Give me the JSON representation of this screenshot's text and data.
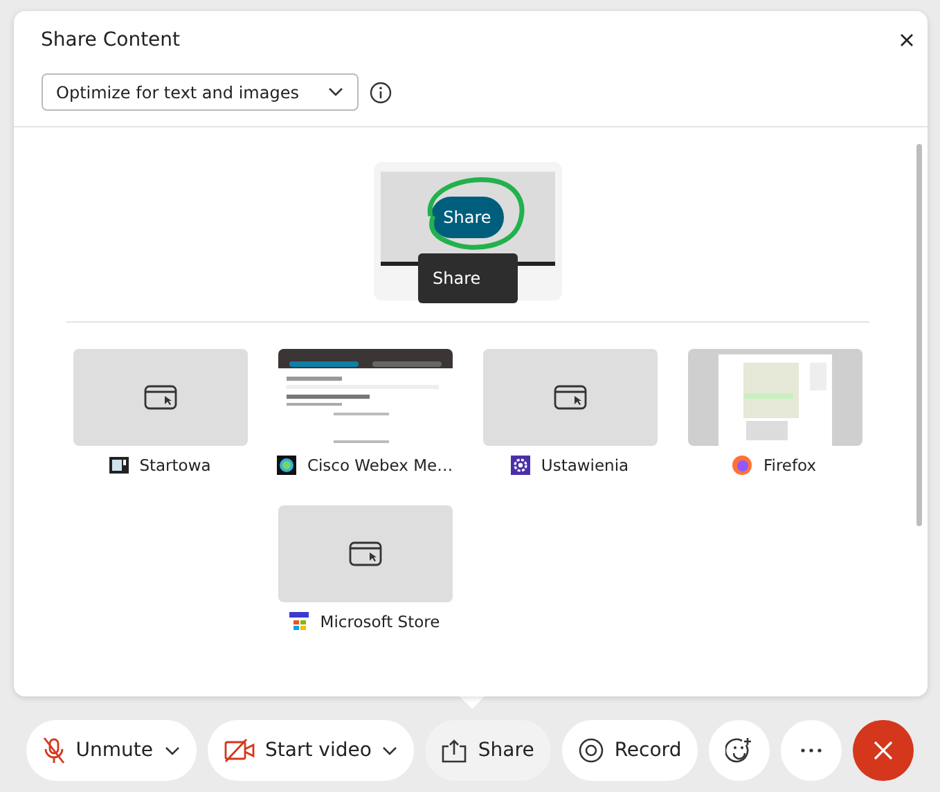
{
  "dialog": {
    "title": "Share Content",
    "optimize": {
      "value": "Optimize for text and images"
    },
    "featured": {
      "button": "Share",
      "tooltip": "Share"
    },
    "windows": [
      {
        "label": "Startowa",
        "kind": "startowa"
      },
      {
        "label": "Cisco Webex Me…",
        "kind": "webex"
      },
      {
        "label": "Ustawienia",
        "kind": "settings"
      },
      {
        "label": "Firefox",
        "kind": "firefox"
      },
      {
        "label": "Microsoft Store",
        "kind": "store"
      }
    ]
  },
  "toolbar": [
    {
      "kind": "mic",
      "label": "Unmute",
      "dropdown": true,
      "selected": false
    },
    {
      "kind": "video",
      "label": "Start video",
      "dropdown": true,
      "selected": false
    },
    {
      "kind": "share",
      "label": "Share",
      "dropdown": false,
      "selected": true
    },
    {
      "kind": "record",
      "label": "Record",
      "dropdown": false,
      "selected": false
    },
    {
      "kind": "emoji",
      "dropdown": false,
      "selected": false
    },
    {
      "kind": "more",
      "dropdown": false,
      "selected": false
    },
    {
      "kind": "end",
      "dropdown": false,
      "selected": false
    }
  ]
}
